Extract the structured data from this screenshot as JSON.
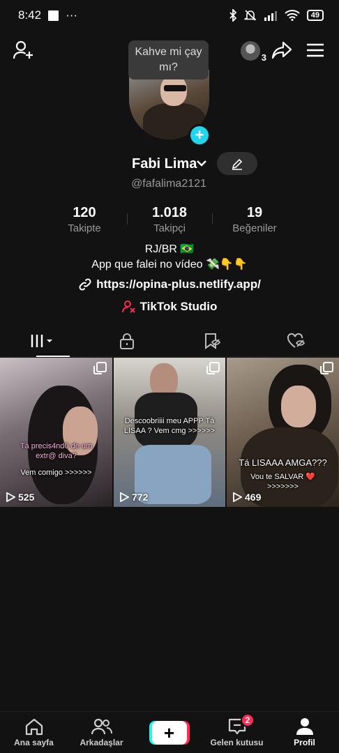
{
  "status_bar": {
    "time": "8:42",
    "menu_dots": "···",
    "battery": "49"
  },
  "tooltip": {
    "text": "Kahve mi çay mı?"
  },
  "visitors": {
    "count": "3"
  },
  "profile": {
    "display_name": "Fabi Lima",
    "username": "@fafalima2121",
    "stats": [
      {
        "value": "120",
        "label": "Takipte"
      },
      {
        "value": "1.018",
        "label": "Takipçi"
      },
      {
        "value": "19",
        "label": "Beğeniler"
      }
    ],
    "bio_line1": "RJ/BR 🇧🇷",
    "bio_line2": "App que falei no vídeo 💸👇👇",
    "link": "https://opina-plus.netlify.app/",
    "studio": "TikTok Studio"
  },
  "videos": [
    {
      "caption": "Tá precis4nd0 de um extr@ diva?",
      "caption2": "Vem comigo >>>>>>",
      "views": "525"
    },
    {
      "caption": "Descoobriiii meu APPP Tá LISAA ? Vem cmg >>>>>>",
      "caption2": "",
      "views": "772"
    },
    {
      "caption": "Tá LISAAA AMGA???",
      "caption2": "Vou te SALVAR ❤️ >>>>>>>",
      "views": "469"
    }
  ],
  "nav": {
    "home": "Ana sayfa",
    "friends": "Arkadaşlar",
    "inbox": "Gelen kutusu",
    "inbox_badge": "2",
    "profile": "Profil"
  },
  "colors": {
    "accent_cyan": "#20d5ec",
    "accent_red": "#fe2c55",
    "background": "#121212"
  }
}
